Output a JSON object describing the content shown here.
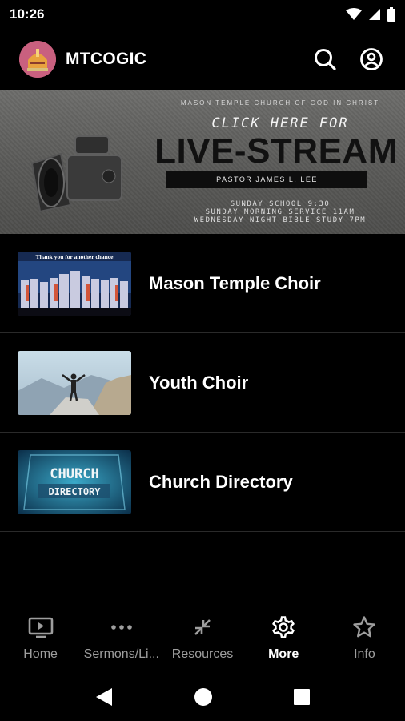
{
  "status_bar": {
    "time": "10:26"
  },
  "app_bar": {
    "title": "MTCOGIC",
    "search_icon": "search-icon",
    "account_icon": "account-icon"
  },
  "banner": {
    "church_name": "MASON TEMPLE CHURCH OF GOD IN CHRIST",
    "click_text": "CLICK HERE FOR",
    "headline": "LIVE-STREAM",
    "pastor": "PASTOR JAMES L. LEE",
    "schedule_line1": "SUNDAY SCHOOL 9:30",
    "schedule_line2": "SUNDAY MORNING SERVICE 11AM",
    "schedule_line3": "WEDNESDAY NIGHT BIBLE STUDY 7PM"
  },
  "list": {
    "items": [
      {
        "label": "Mason Temple Choir",
        "thumb_caption": "Thank you for another chance"
      },
      {
        "label": "Youth Choir"
      },
      {
        "label": "Church Directory",
        "thumb_line1": "CHURCH",
        "thumb_line2": "DIRECTORY"
      }
    ]
  },
  "bottom_nav": {
    "items": [
      {
        "label": "Home",
        "icon": "tv-icon"
      },
      {
        "label": "Sermons/Li...",
        "icon": "more-dots-icon"
      },
      {
        "label": "Resources",
        "icon": "collapse-arrows-icon"
      },
      {
        "label": "More",
        "icon": "gear-icon",
        "active": true
      },
      {
        "label": "Info",
        "icon": "star-icon"
      }
    ]
  },
  "colors": {
    "background": "#000000",
    "active": "#ffffff",
    "inactive": "#9e9e9e"
  }
}
